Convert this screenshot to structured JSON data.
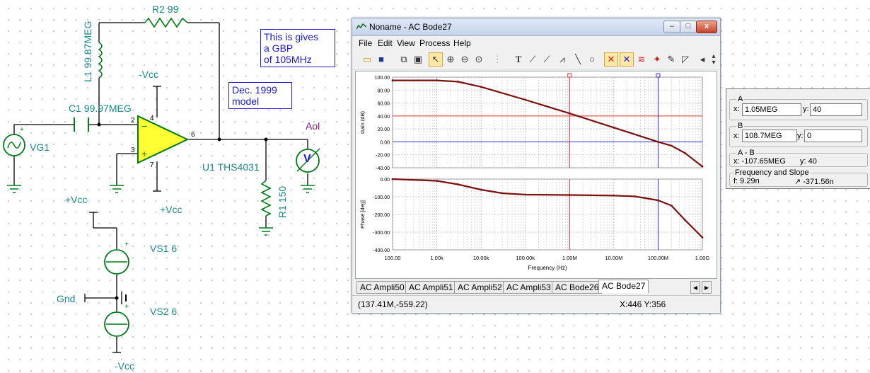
{
  "schematic": {
    "r2_label": "R2 99",
    "l1_label": "L1 99.87MEG",
    "c1_label": "C1 99.97MEG",
    "vg1_label": "VG1",
    "u1_label": "U1 THS4031",
    "r1_label": "R1 150",
    "aol_label": "Aol",
    "meter_glyph": "V",
    "vs1_label": "VS1 6",
    "vs2_label": "VS2 6",
    "gnd_label": "Gnd",
    "vcc_top": "-Vcc",
    "vcc_bottom": "+Vcc",
    "vcc_supply": "+Vcc",
    "vcc_supply_bottom": "-Vcc",
    "pin_labels": [
      "2",
      "3",
      "4",
      "6",
      "7"
    ],
    "plus_sign": "+",
    "minus_sign": "−",
    "note1": [
      "This is gives",
      "a GBP",
      "of 105MHz"
    ],
    "note2": [
      "Dec. 1999",
      "model"
    ]
  },
  "window": {
    "title": "Noname - AC Bode27",
    "buttons": {
      "minimize": "–",
      "maximize": "□",
      "close": "x"
    },
    "menu": [
      "File",
      "Edit",
      "View",
      "Process",
      "Help"
    ],
    "toolbar_icons": [
      "open-icon",
      "save-icon",
      "copy-icon",
      "paste-icon",
      "pointer-icon",
      "zoom-in-icon",
      "zoom-out-icon",
      "zoom-fit-icon",
      "grid-icon",
      "text-icon",
      "cursor-a-icon",
      "cursor-b-icon",
      "slope-icon",
      "line-icon",
      "circle-icon",
      "cursor-ab-icon",
      "cursor-ba-icon",
      "curve-add-icon",
      "marker-icon",
      "pen-icon",
      "triangle-icon",
      "scroll-left-icon",
      "spin-icon"
    ],
    "tabs": [
      "AC Ampli50",
      "AC Ampli51",
      "AC Ampli52",
      "AC Ampli53",
      "AC Bode26",
      "AC Bode27"
    ],
    "selected_tab": "AC Bode27",
    "tab_scroll": [
      "◂",
      "▸"
    ],
    "status_left": "(137.41M,-559.22)",
    "status_right": "X:446  Y:356"
  },
  "chart_data": [
    {
      "type": "line",
      "title": "",
      "xlabel": "",
      "ylabel": "Gain (dB)",
      "x_scale": "log",
      "x": [
        100,
        1000,
        3000,
        10000,
        100000,
        1000000,
        10000000,
        100000000,
        200000000,
        400000000,
        1000000000
      ],
      "series": [
        {
          "values": [
            95,
            95,
            93,
            85,
            65,
            44,
            22,
            0,
            -6,
            -17,
            -38
          ],
          "color": "#7a1010"
        }
      ],
      "ylim": [
        -40,
        100
      ],
      "yticks": [
        "100.00",
        "80.00",
        "60.00",
        "40.00",
        "20.00",
        "0.00",
        "-20.00",
        "-40.00"
      ],
      "cursor_lines": {
        "horizontal_red": 40,
        "horizontal_blue": 0,
        "vertical_red": 1000000,
        "vertical_blue": 100000000
      },
      "cursor_markers": [
        "a",
        "b"
      ],
      "grid": true
    },
    {
      "type": "line",
      "title": "",
      "xlabel": "Frequency (Hz)",
      "ylabel": "Phase [deg]",
      "x_scale": "log",
      "x": [
        100,
        1000,
        3000,
        10000,
        30000,
        100000,
        1000000,
        10000000,
        30000000,
        100000000,
        200000000,
        400000000,
        1000000000
      ],
      "series": [
        {
          "values": [
            0,
            -10,
            -30,
            -60,
            -80,
            -88,
            -90,
            -93,
            -98,
            -120,
            -150,
            -230,
            -330
          ],
          "color": "#7a1010"
        }
      ],
      "ylim": [
        -400,
        0
      ],
      "yticks": [
        "0.00",
        "-100.00",
        "-200.00",
        "-300.00",
        "-400.00"
      ],
      "xticks": [
        "100.00",
        "1.00k",
        "10.00k",
        "100.00k",
        "1.00M",
        "10.00M",
        "100.00M",
        "1.00G"
      ],
      "cursor_lines": {
        "vertical_red": 1000000,
        "vertical_blue": 100000000
      },
      "grid": true
    }
  ],
  "cursors": {
    "a_title": "A",
    "a_x_label": "x:",
    "a_x": "1.05MEG",
    "a_y_label": "y:",
    "a_y": "40",
    "b_title": "B",
    "b_x_label": "x:",
    "b_x": "108.7MEG",
    "b_y_label": "y:",
    "b_y": "0",
    "diff_title": "A - B",
    "diff_x": "x:  -107.65MEG",
    "diff_y": "y: 40",
    "slope_title": "Frequency and Slope",
    "freq": "f:  9.29n",
    "slope": "↗  -371.56n"
  }
}
